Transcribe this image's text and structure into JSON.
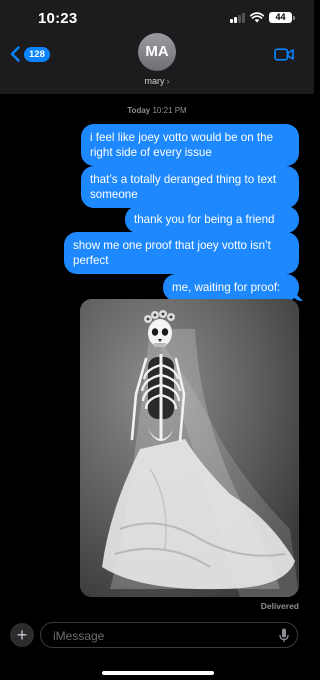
{
  "status_bar": {
    "time": "10:23",
    "battery": "44"
  },
  "header": {
    "back_badge": "128",
    "avatar_initials": "MA",
    "contact_name": "mary",
    "contact_chevron": "›",
    "accent_color": "#0a84ff"
  },
  "thread": {
    "timestamp_day": "Today",
    "timestamp_time": "10:21 PM",
    "messages": [
      {
        "text": "i feel like joey votto would be on the right side of every issue"
      },
      {
        "text": "that’s a totally deranged thing to text someone"
      },
      {
        "text": "thank you for being a friend"
      },
      {
        "text": "show me one proof that joey votto isn’t perfect"
      },
      {
        "text": "me, waiting for proof:"
      }
    ],
    "bubble_color": "#1e88ff",
    "photo_subject": "skeleton-bride-image",
    "status": "Delivered"
  },
  "composer": {
    "placeholder": "iMessage",
    "plus_icon": "+"
  },
  "icons": {
    "back": "chevron-left-icon",
    "video": "video-camera-icon",
    "mic": "microphone-icon",
    "signal": "cellular-signal-icon",
    "wifi": "wifi-icon",
    "battery": "battery-icon"
  }
}
